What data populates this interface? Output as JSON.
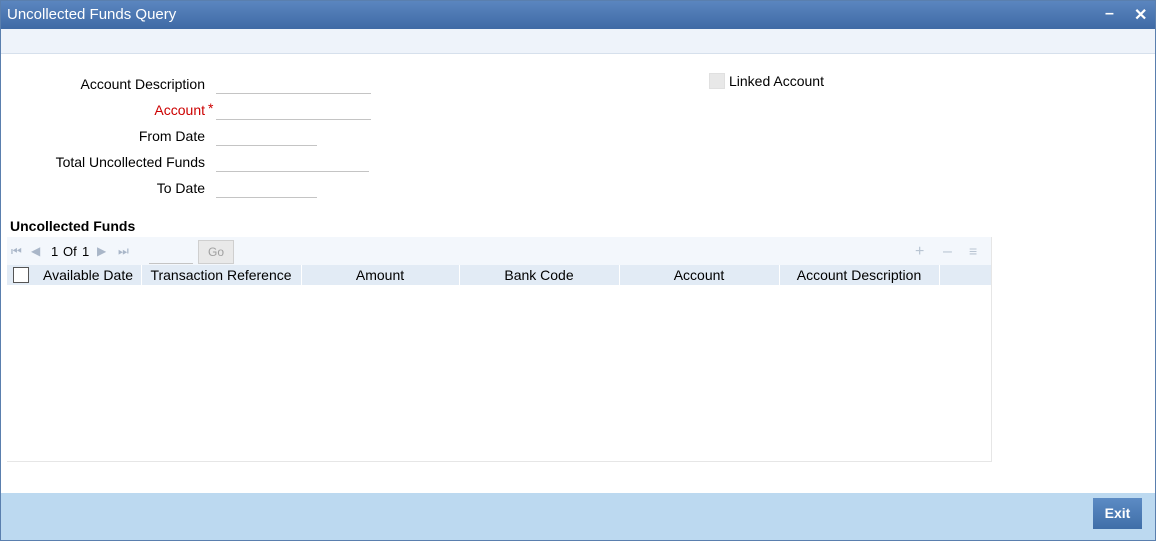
{
  "window": {
    "title": "Uncollected Funds Query"
  },
  "form": {
    "account_description_label": "Account Description",
    "account_label": "Account",
    "required_mark": "*",
    "from_date_label": "From Date",
    "total_uncollected_label": "Total Uncollected Funds",
    "to_date_label": "To Date",
    "linked_account_label": "Linked Account",
    "account_description_value": "",
    "account_value": "",
    "from_date_value": "",
    "total_uncollected_value": "",
    "to_date_value": "",
    "linked_account_checked": false
  },
  "grid": {
    "title": "Uncollected Funds",
    "pager": {
      "current": "1",
      "of_label": "Of",
      "total": "1",
      "go_label": "Go"
    },
    "columns": [
      "Available Date",
      "Transaction Reference",
      "Amount",
      "Bank Code",
      "Account",
      "Account Description"
    ],
    "rows": []
  },
  "footer": {
    "exit_label": "Exit"
  }
}
